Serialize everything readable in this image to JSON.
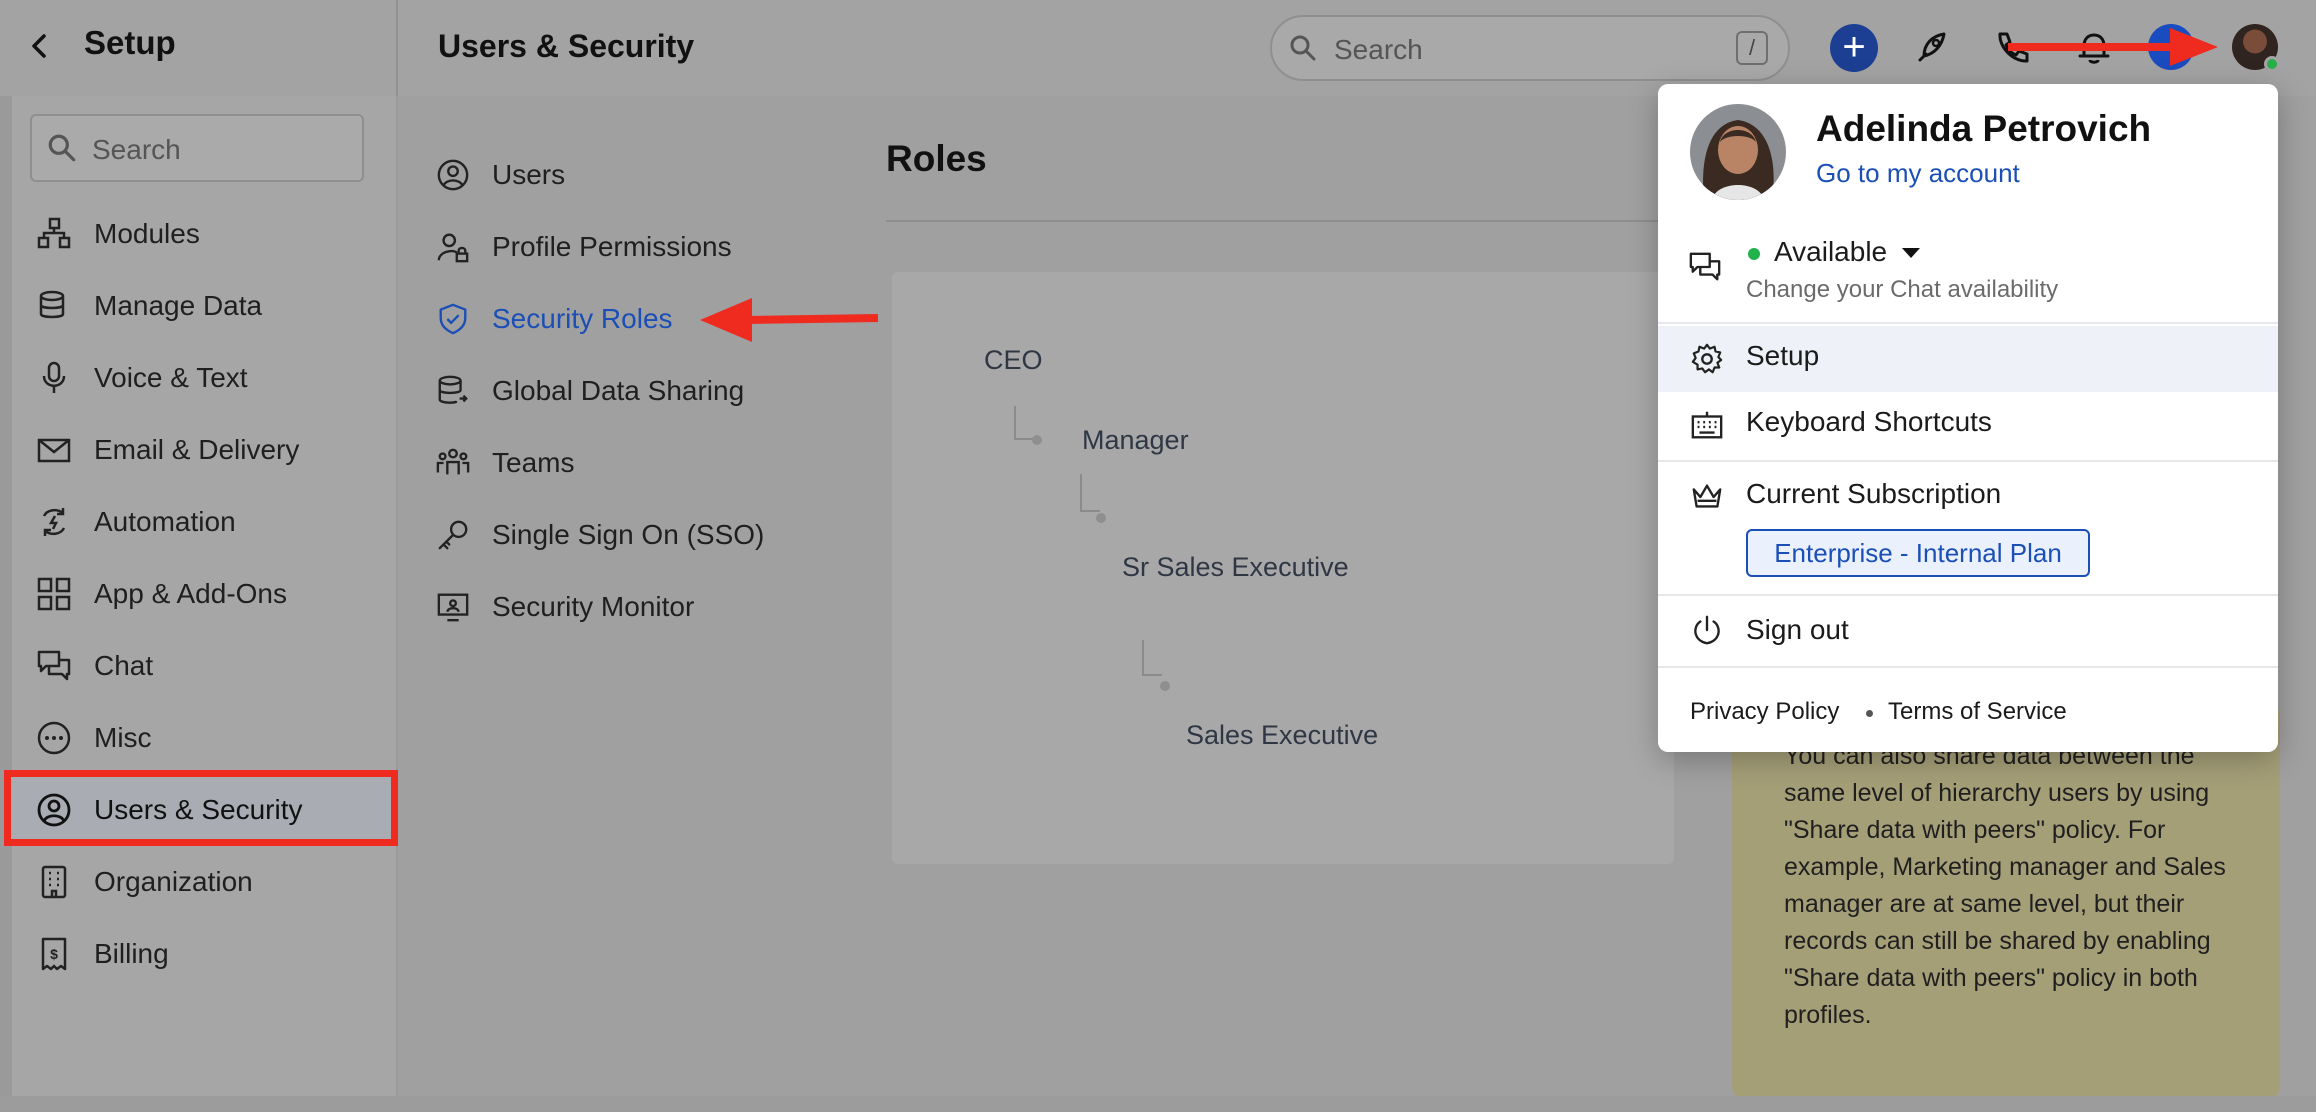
{
  "header": {
    "back_label": "Setup",
    "page_title": "Users & Security",
    "search_placeholder": "Search",
    "search_shortcut": "/"
  },
  "sidebar": {
    "search_placeholder": "Search",
    "items": [
      {
        "label": "Modules",
        "icon": "modules-icon"
      },
      {
        "label": "Manage Data",
        "icon": "database-icon"
      },
      {
        "label": "Voice & Text",
        "icon": "microphone-icon"
      },
      {
        "label": "Email & Delivery",
        "icon": "mail-icon"
      },
      {
        "label": "Automation",
        "icon": "automation-icon"
      },
      {
        "label": "App & Add-Ons",
        "icon": "apps-grid-icon"
      },
      {
        "label": "Chat",
        "icon": "chat-icon"
      },
      {
        "label": "Misc",
        "icon": "more-icon"
      },
      {
        "label": "Users & Security",
        "icon": "user-circle-icon",
        "active": true
      },
      {
        "label": "Organization",
        "icon": "building-icon"
      },
      {
        "label": "Billing",
        "icon": "receipt-icon"
      }
    ]
  },
  "submenu": {
    "items": [
      {
        "label": "Users",
        "icon": "user-circle-icon"
      },
      {
        "label": "Profile Permissions",
        "icon": "user-lock-icon"
      },
      {
        "label": "Security Roles",
        "icon": "shield-icon",
        "active": true
      },
      {
        "label": "Global Data Sharing",
        "icon": "database-share-icon"
      },
      {
        "label": "Teams",
        "icon": "team-icon"
      },
      {
        "label": "Single Sign On (SSO)",
        "icon": "key-icon"
      },
      {
        "label": "Security Monitor",
        "icon": "monitor-icon"
      }
    ]
  },
  "roles": {
    "heading": "Roles",
    "tree": [
      "CEO",
      "Manager",
      "Sr Sales Executive",
      "Sales Executive"
    ]
  },
  "note": {
    "text": "You can also share data between the same level of hierarchy users by using \"Share data with peers\" policy. For example, Marketing manager and Sales manager are at same level, but their records can still be shared by enabling \"Share data with peers\" policy in both profiles."
  },
  "profile_menu": {
    "name": "Adelinda Petrovich",
    "account_link": "Go to my account",
    "status": "Available",
    "status_sub": "Change your Chat availability",
    "setup": "Setup",
    "shortcuts": "Keyboard Shortcuts",
    "subscription": "Current Subscription",
    "plan": "Enterprise - Internal Plan",
    "sign_out": "Sign out",
    "privacy": "Privacy Policy",
    "terms": "Terms of Service"
  },
  "colors": {
    "accent": "#1b4fb6",
    "annotation": "#ef2b1f",
    "available": "#22b24c"
  }
}
